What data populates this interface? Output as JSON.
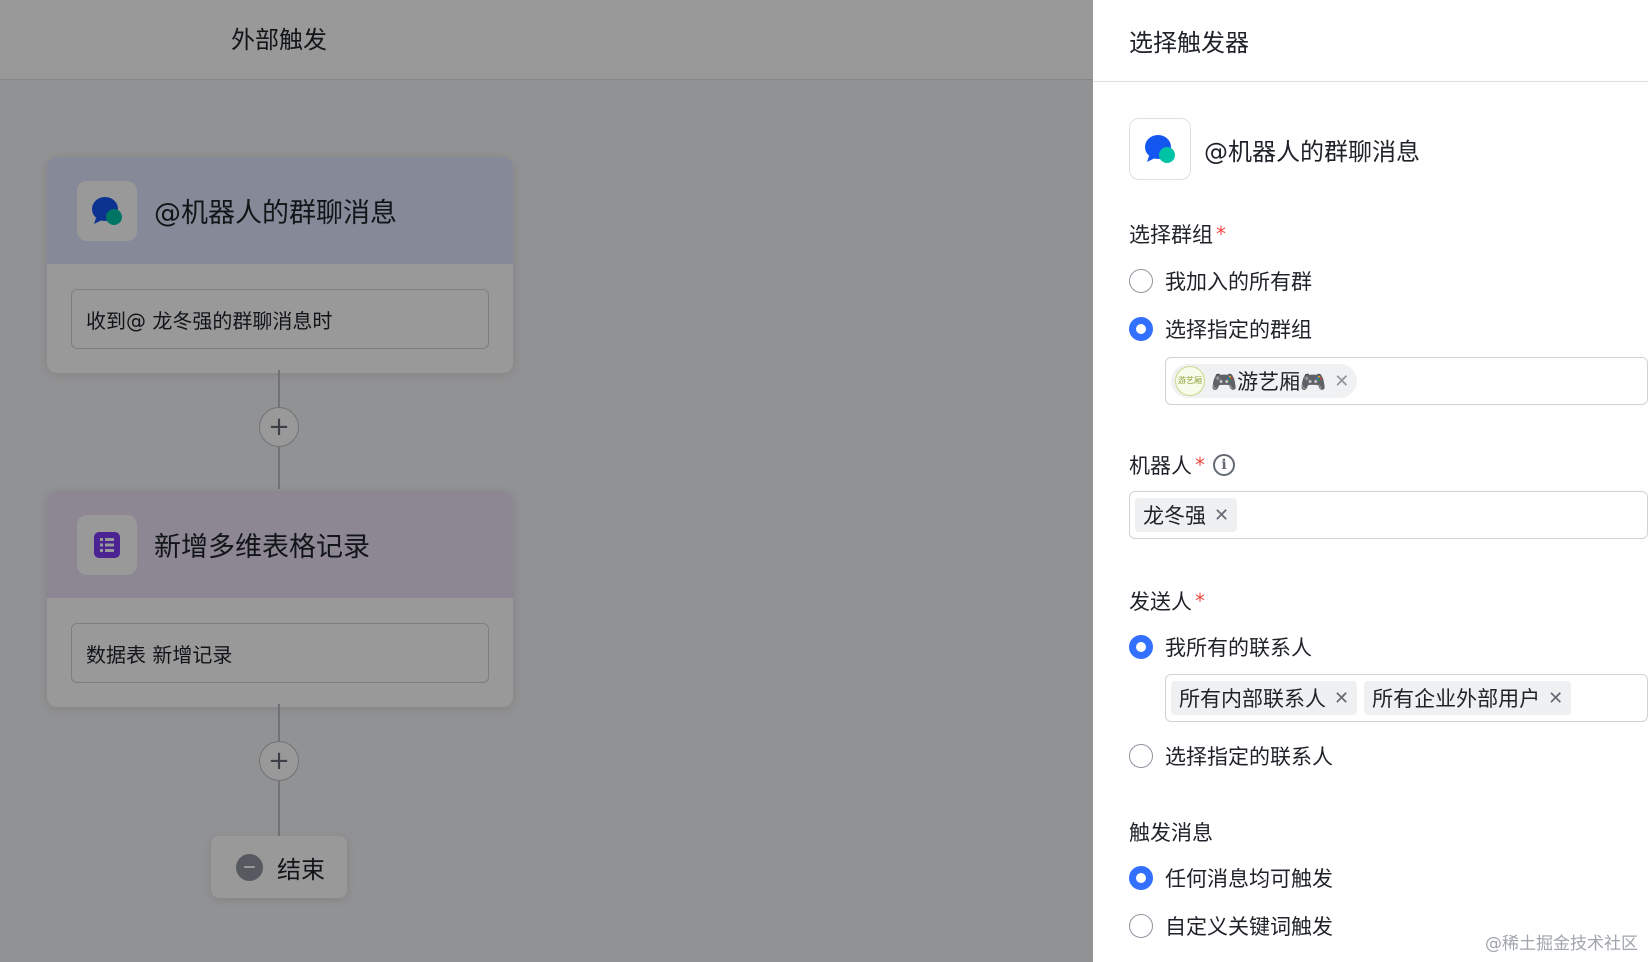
{
  "canvas": {
    "title": "外部触发",
    "trigger_card": {
      "title": "@机器人的群聊消息",
      "description": "收到@ 龙冬强的群聊消息时",
      "icon": "chat-bubble-icon"
    },
    "action_card": {
      "title": "新增多维表格记录",
      "description": "数据表 新增记录",
      "icon": "bitable-icon"
    },
    "add_button_label": "+",
    "end_label": "结束"
  },
  "panel": {
    "title": "选择触发器",
    "trigger_name": "@机器人的群聊消息",
    "group_section": {
      "label": "选择群组",
      "required_mark": "*",
      "options": [
        "我加入的所有群",
        "选择指定的群组"
      ],
      "selected_index": 1,
      "selected_group": {
        "avatar_text": "游艺厢",
        "name": "🎮游艺厢🎮"
      }
    },
    "robot_section": {
      "label": "机器人",
      "required_mark": "*",
      "info_icon": "i",
      "tags": [
        "龙冬强"
      ]
    },
    "sender_section": {
      "label": "发送人",
      "required_mark": "*",
      "options": [
        "我所有的联系人",
        "选择指定的联系人"
      ],
      "selected_index": 0,
      "tags": [
        "所有内部联系人",
        "所有企业外部用户"
      ]
    },
    "message_section": {
      "label": "触发消息",
      "options": [
        "任何消息均可触发",
        "自定义关键词触发"
      ],
      "selected_index": 0
    },
    "tag_remove_glyph": "✕"
  },
  "watermark": "@稀土掘金技术社区",
  "colors": {
    "accent": "#3370ff",
    "required": "#f54a45",
    "trigger_header": "#dfe7fd",
    "action_header": "#e9e1f6",
    "action_icon": "#7f3bf5"
  }
}
